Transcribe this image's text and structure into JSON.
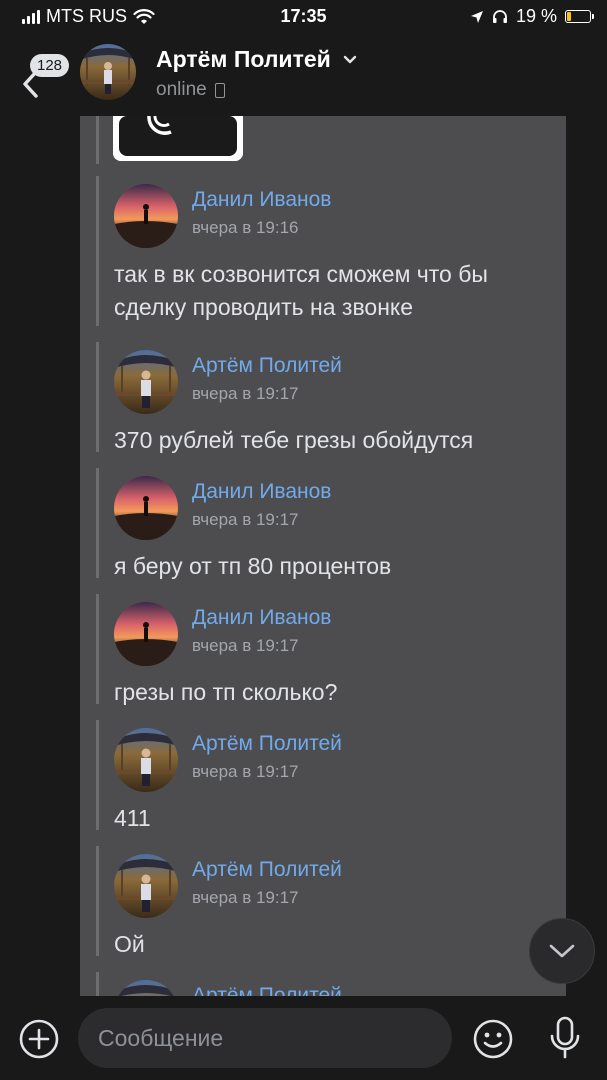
{
  "status_bar": {
    "carrier": "MTS RUS",
    "time": "17:35",
    "battery_text": "19 %",
    "battery_level": 0.19,
    "icons": [
      "signal-icon",
      "wifi-icon",
      "location-arrow-icon",
      "headphones-icon",
      "battery-charging-icon"
    ]
  },
  "header": {
    "unread_count": "128",
    "contact_name": "Артём Политей",
    "status": "online"
  },
  "forwarded_messages": [
    {
      "author": "Данил Иванов",
      "time": "вчера в 19:16",
      "text": "так в вк созвонится сможем что бы сделку проводить на звонке",
      "avatar": "sunset-avatar"
    },
    {
      "author": "Артём Политей",
      "time": "вчера в 19:17",
      "text": "370 рублей тебе грезы обойдутся",
      "avatar": "park-avatar"
    },
    {
      "author": "Данил Иванов",
      "time": "вчера в 19:17",
      "text": "я беру от тп 80 процентов",
      "avatar": "sunset-avatar"
    },
    {
      "author": "Данил Иванов",
      "time": "вчера в 19:17",
      "text": "грезы по тп сколько?",
      "avatar": "sunset-avatar"
    },
    {
      "author": "Артём Политей",
      "time": "вчера в 19:17",
      "text": "411",
      "avatar": "park-avatar"
    },
    {
      "author": "Артём Политей",
      "time": "вчера в 19:17",
      "text": "Ой",
      "avatar": "park-avatar"
    },
    {
      "author": "Артём Политей",
      "time": "",
      "text": "",
      "avatar": "park-avatar"
    }
  ],
  "composer": {
    "placeholder": "Сообщение"
  },
  "colors": {
    "background": "#19191a",
    "card": "#4d4d4f",
    "link_blue": "#71aaeb",
    "muted": "#909499"
  }
}
